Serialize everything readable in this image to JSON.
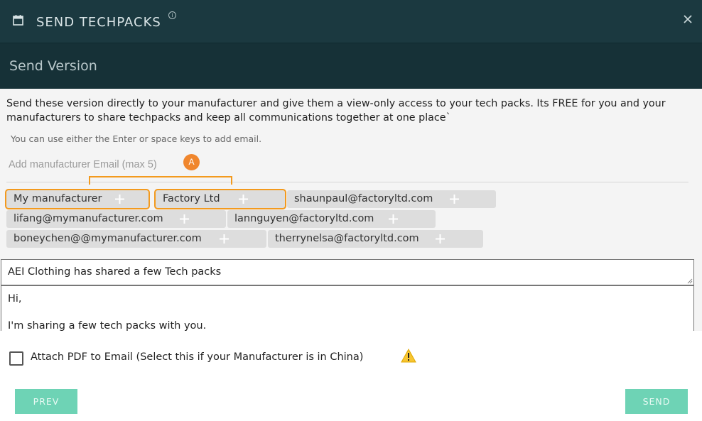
{
  "header": {
    "title": "SEND TECHPACKS",
    "info_glyph": "i",
    "icons": {
      "calendar": "calendar-icon",
      "info": "info-icon",
      "close": "close-icon"
    }
  },
  "subheader": {
    "title": "Send Version"
  },
  "intro_text": "Send these version directly to your manufacturer and give them a view-only access to your tech packs. Its FREE for you and your manufacturers to share techpacks and keep all communications together at one place`",
  "hint_text": "You can use either the Enter or space keys to add email.",
  "email_input": {
    "placeholder": "Add manufacturer Email (max 5)",
    "value": ""
  },
  "annotation_badge": "A",
  "chips": [
    {
      "label": "My manufacturer",
      "highlighted": true
    },
    {
      "label": "Factory Ltd",
      "highlighted": true
    },
    {
      "label": "shaunpaul@factoryltd.com",
      "highlighted": false
    },
    {
      "label": "lifang@mymanufacturer.com",
      "highlighted": false
    },
    {
      "label": "lannguyen@factoryltd.com",
      "highlighted": false
    },
    {
      "label": "boneychen@@mymanufacturer.com",
      "highlighted": false
    },
    {
      "label": "therrynelsa@factoryltd.com",
      "highlighted": false
    }
  ],
  "subject": "AEI Clothing has shared a few Tech packs",
  "message": {
    "line1": "Hi,",
    "line2": "I'm sharing a few tech packs with you."
  },
  "attach_pdf": {
    "label": "Attach PDF to Email (Select this if your Manufacturer is in China)",
    "checked": false,
    "icon": "warning-icon"
  },
  "buttons": {
    "prev": "PREV",
    "send": "SEND"
  },
  "colors": {
    "header_bg": "#1b3940",
    "subheader_bg": "#163137",
    "accent_orange": "#f39a1e",
    "button_green": "#6ed3b5",
    "chip_bg": "#dddddd"
  }
}
